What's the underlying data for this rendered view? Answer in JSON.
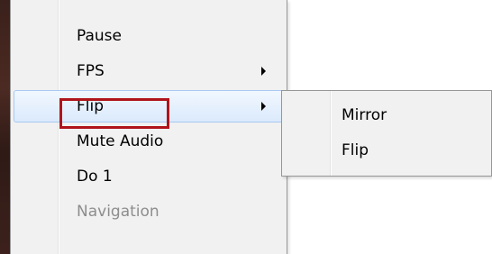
{
  "context_menu": {
    "items": [
      {
        "label": "Pause",
        "has_submenu": false,
        "disabled": false
      },
      {
        "label": "FPS",
        "has_submenu": true,
        "disabled": false
      },
      {
        "label": "Flip",
        "has_submenu": true,
        "disabled": false,
        "active": true
      },
      {
        "label": "Mute Audio",
        "has_submenu": false,
        "disabled": false
      },
      {
        "label": "Do 1",
        "has_submenu": false,
        "disabled": false
      },
      {
        "label": "Navigation",
        "has_submenu": false,
        "disabled": true
      }
    ]
  },
  "submenu": {
    "items": [
      {
        "label": "Mirror"
      },
      {
        "label": "Flip"
      }
    ]
  },
  "colors": {
    "menu_bg": "#f1f1f1",
    "highlight_border": "#b0141b",
    "active_item_border": "#a9c9f2",
    "disabled_text": "#8d8d8d"
  }
}
